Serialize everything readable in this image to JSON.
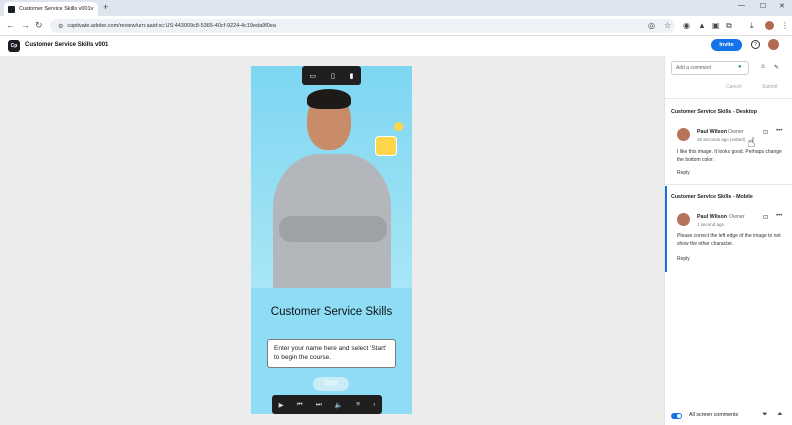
{
  "browser": {
    "tab_title": "Customer Service Skills v001",
    "url": "captivate.adobe.com/review/urn:aaid:sc:US:443009c8-5365-40cf-9224-4c19eda9f0ea",
    "newtab_glyph": "+",
    "close_glyph": "×"
  },
  "app": {
    "logo": "Cp",
    "title": "Customer Service Skills v001",
    "invite_label": "Invite",
    "help_glyph": "?"
  },
  "slide": {
    "title": "Customer Service Skills",
    "input_text": "Enter your name here and select 'Start' to begin the course.",
    "start_label": "Start"
  },
  "panel": {
    "add_placeholder": "Add a comment",
    "cancel_label": "Cancel",
    "submit_label": "Submit",
    "sections": [
      {
        "title": "Customer Service Skills - Desktop",
        "comment": {
          "author": "Paul Wilson",
          "role": "Owner",
          "time": "35 seconds ago (edited)",
          "body": "I like this image. It looks good. Perhaps change the bottom color.",
          "reply": "Reply"
        }
      },
      {
        "title": "Customer Service Skills - Mobile",
        "comment": {
          "author": "Paul Wilson",
          "role": "Owner",
          "time": "1 second ago",
          "body": "Please correct the left edge of the image to not show the other character.",
          "reply": "Reply"
        }
      }
    ],
    "footer_label": "All screen comments"
  },
  "colors": {
    "accent": "#1473e6",
    "slide_bg": "#8fdcf5"
  }
}
